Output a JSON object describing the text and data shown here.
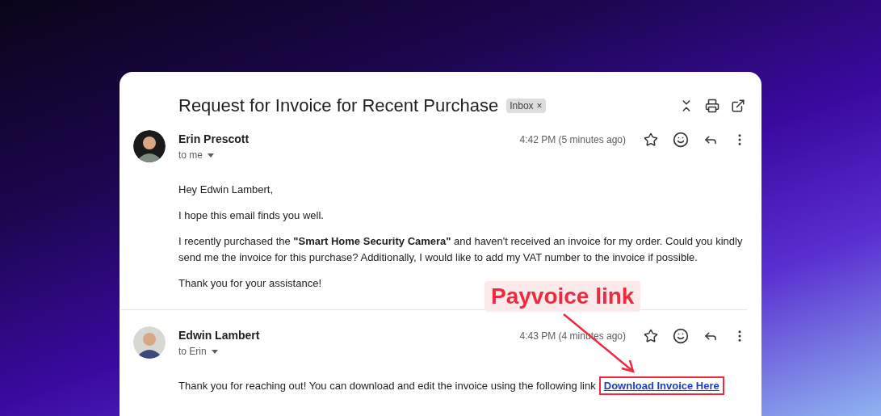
{
  "subject": "Request for Invoice for Recent Purchase",
  "label": {
    "text": "Inbox",
    "close": "×"
  },
  "messages": [
    {
      "sender": "Erin Prescott",
      "recipient": "to me",
      "time": "4:42 PM (5 minutes ago)",
      "color": "#1a1a1a",
      "paragraphs": [
        "Hey Edwin Lambert,",
        "I hope this email finds you well.",
        "I recently purchased the **\"Smart Home Security Camera\"** and haven't received an invoice for my order. Could you kindly send me the invoice for this purchase? Additionally, I would like to add my VAT number to the invoice if possible.",
        "Thank you for your assistance!"
      ]
    },
    {
      "sender": "Edwin Lambert",
      "recipient": "to Erin",
      "time": "4:43 PM (4 minutes ago)",
      "color": "#d8d8d2",
      "paragraphs": [
        "Thank you for reaching out! You can download and edit the invoice using the following link"
      ],
      "link": "Download Invoice Here"
    }
  ],
  "annotation": {
    "text": "Payvoice link",
    "highlight_link": true
  }
}
